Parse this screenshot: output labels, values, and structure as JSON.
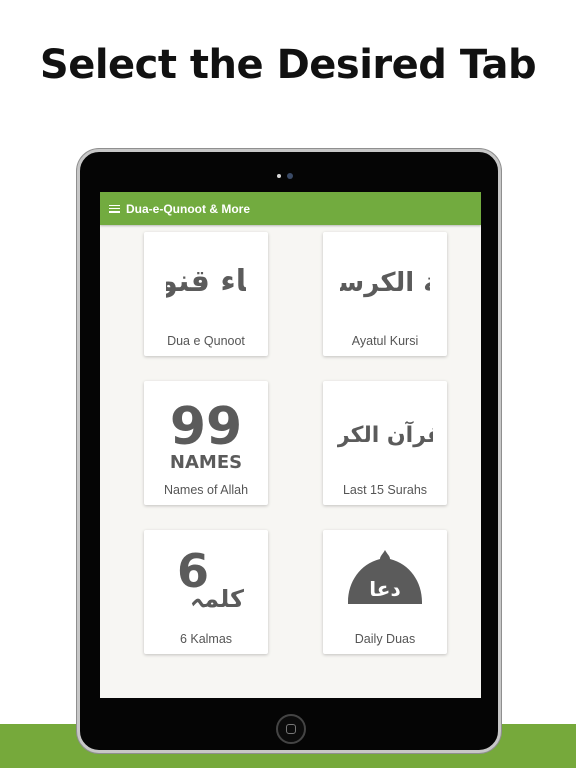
{
  "promo": {
    "headline": "Select the Desired Tab"
  },
  "appbar": {
    "menu_icon": "hamburger-menu-icon",
    "title": "Dua-e-Qunoot & More"
  },
  "tiles": [
    {
      "label": "Dua e Qunoot",
      "icon": "dua-e-qunoot-calligraphy-icon",
      "arabic": "دعاء قنوت"
    },
    {
      "label": "Ayatul Kursi",
      "icon": "ayatul-kursi-calligraphy-icon",
      "arabic": "آية الكرسي"
    },
    {
      "label": "Names of Allah",
      "icon": "99-names-icon",
      "number": "99",
      "caption": "NAMES"
    },
    {
      "label": "Last 15 Surahs",
      "icon": "quran-kareem-calligraphy-icon",
      "arabic": "القرآن الكريم"
    },
    {
      "label": "6 Kalmas",
      "icon": "6-kalmas-icon",
      "number": "6",
      "arabic": "كلمہ"
    },
    {
      "label": "Daily Duas",
      "icon": "mosque-dome-dua-icon",
      "arabic": "دعا"
    }
  ],
  "colors": {
    "accent": "#72ab3f",
    "ground": "#76a93b",
    "icon_gray": "#5b5b5b"
  }
}
